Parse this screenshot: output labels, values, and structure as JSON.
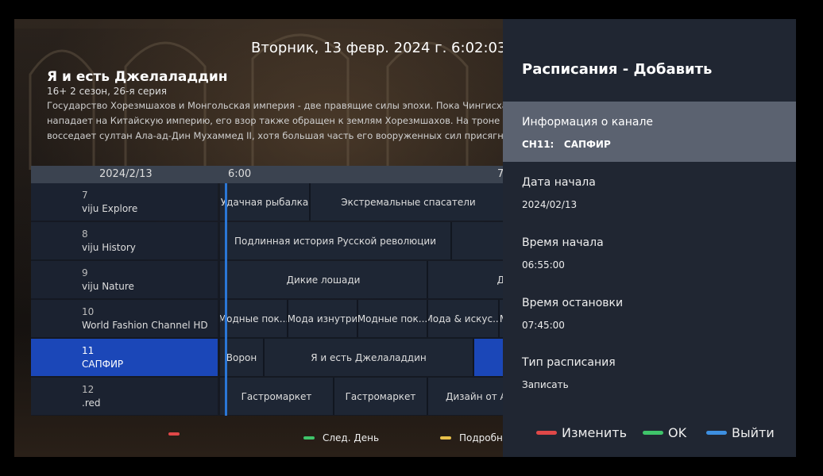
{
  "header": {
    "datetime": "Вторник,  13 февр. 2024 г. 6:02:03"
  },
  "program": {
    "title": "Я и есть Джелаладдин",
    "subtitle": "16+ 2 сезон, 26-я серия",
    "description_lines": [
      "Государство Хорезмшахов и Монгольская империя - две правящие силы эпохи. Пока Чингисхан",
      "нападает на Китайскую империю, его взор также обращен к землям Хорезмшахов. На троне Хоре",
      "восседает султан Ала-ад-Дин Мухаммед II, хотя большая часть его вооруженных сил присягнула к"
    ]
  },
  "epg": {
    "date": "2024/2/13",
    "time_start": "6:00",
    "time_next": "7",
    "channels": [
      {
        "number": "7",
        "name": "viju Explore",
        "programs": [
          "Удачная рыбалка",
          "Экстремальные спасатели"
        ]
      },
      {
        "number": "8",
        "name": "viju History",
        "programs": [
          "Подлинная история Русской революции",
          ""
        ]
      },
      {
        "number": "9",
        "name": "viju Nature",
        "programs": [
          "Дикие лошади",
          "Д"
        ]
      },
      {
        "number": "10",
        "name": "World Fashion Channel HD",
        "programs": [
          "Модные пок...",
          "Мода изнутри",
          "Модные пок...",
          "Мода & искус...",
          "М"
        ]
      },
      {
        "number": "11",
        "name": "САПФИР",
        "programs": [
          "Ворон",
          "Я и есть Джелаладдин",
          ""
        ]
      },
      {
        "number": "12",
        "name": ".red",
        "programs": [
          "Гастромаркет",
          "Гастромаркет",
          "Дизайн от А"
        ]
      }
    ],
    "active_channel_index": 4
  },
  "legend": {
    "next_day": "След. День",
    "details": "Подробне"
  },
  "panel": {
    "title": "Расписания - Добавить",
    "fields": [
      {
        "label": "Информация о канале",
        "value": "CH11:   САПФИР"
      },
      {
        "label": "Дата начала",
        "value": "2024/02/13"
      },
      {
        "label": "Время начала",
        "value": "06:55:00"
      },
      {
        "label": "Время остановки",
        "value": "07:45:00"
      },
      {
        "label": "Тип расписания",
        "value": "Записать"
      }
    ],
    "buttons": {
      "edit": "Изменить",
      "ok": "OK",
      "exit": "Выйти"
    }
  },
  "colors": {
    "red": "#e04848",
    "green": "#3fc46a",
    "yellow": "#e8c04a",
    "blue": "#3d8fe0",
    "highlight": "#1b47b8"
  }
}
